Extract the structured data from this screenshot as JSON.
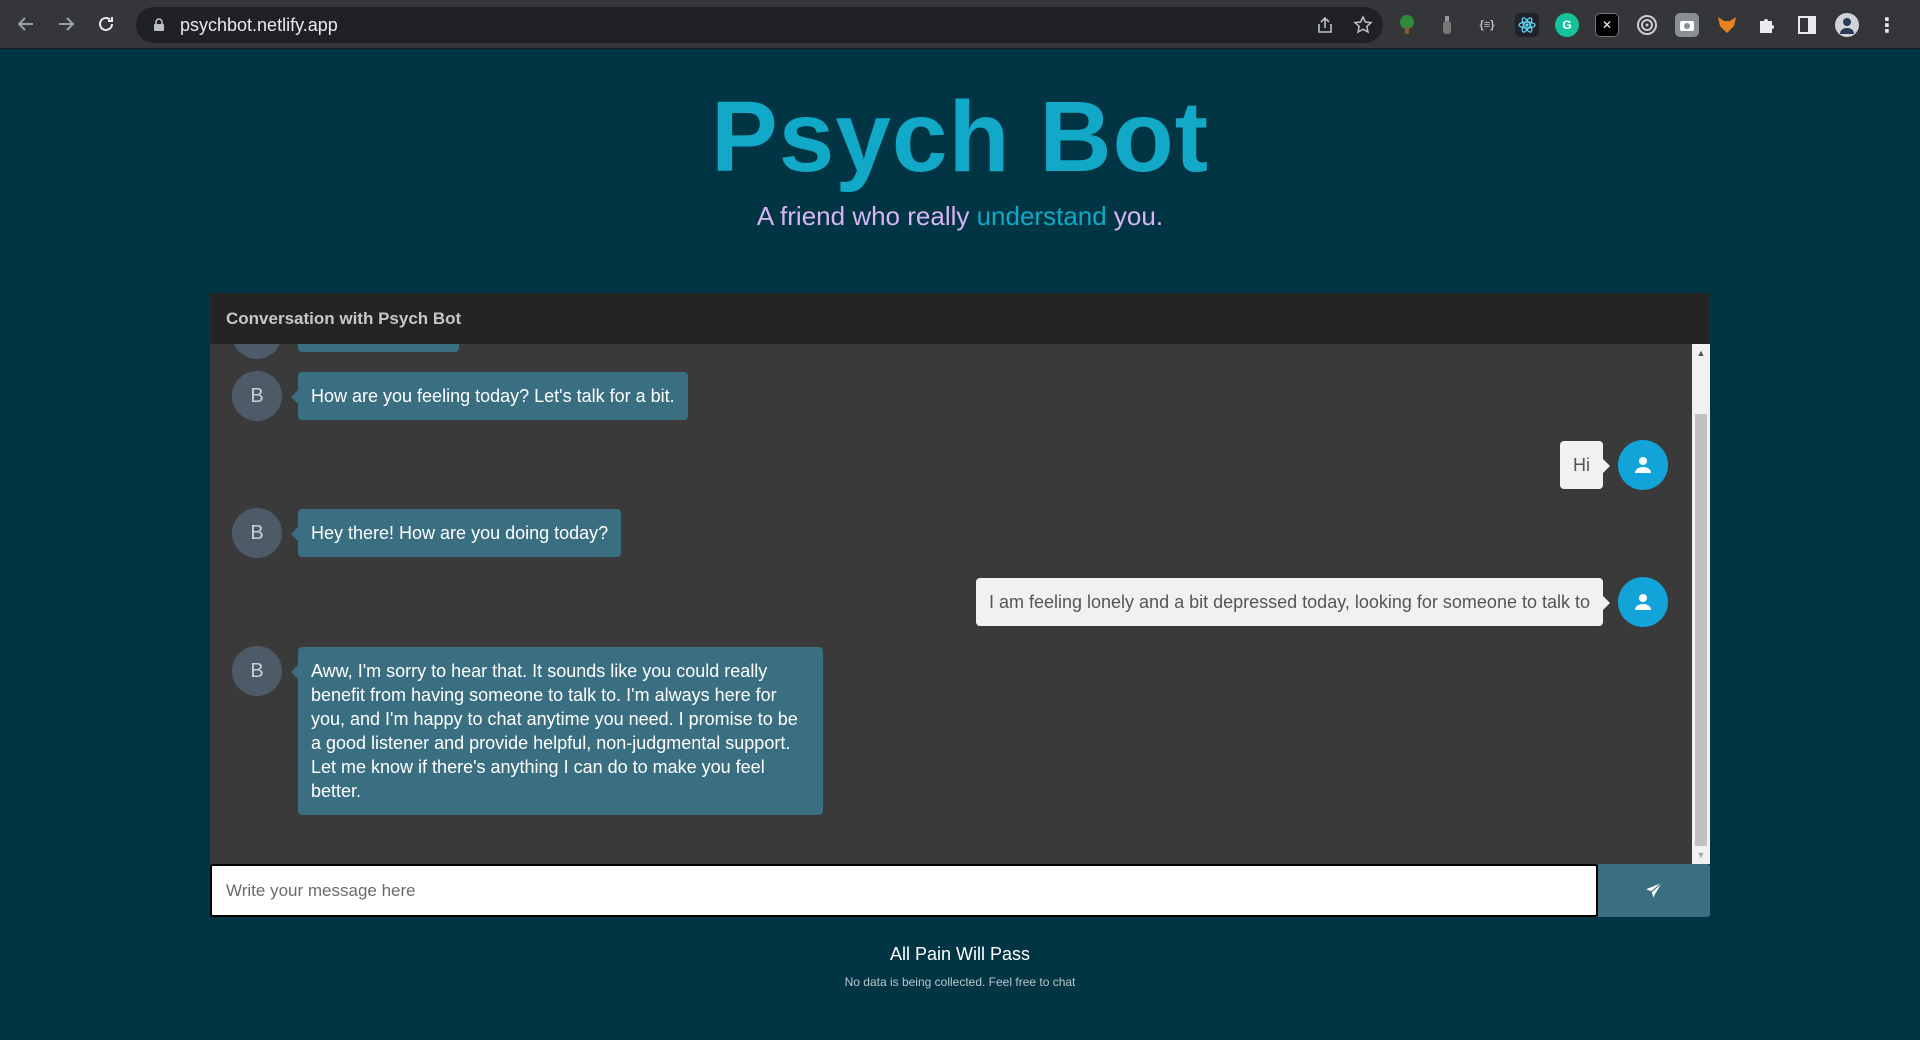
{
  "browser": {
    "url": "psychbot.netlify.app",
    "extensions": [
      "tree-icon",
      "bottle-icon",
      "json-icon",
      "react-icon",
      "grammarly-icon",
      "x-icon",
      "target-icon",
      "camera-icon",
      "fox-icon",
      "puzzle-icon",
      "sidebar-icon",
      "profile-avatar"
    ]
  },
  "header": {
    "title": "Psych Bot",
    "tagline_part1": "A friend who really ",
    "tagline_highlight": "understand",
    "tagline_part2": " you."
  },
  "chat": {
    "header": "Conversation with Psych Bot",
    "bot_initial": "B",
    "messages": [
      {
        "from": "bot",
        "text": "How are you feeling today? Let's talk for a bit."
      },
      {
        "from": "user",
        "text": "Hi"
      },
      {
        "from": "bot",
        "text": "Hey there! How are you doing today?"
      },
      {
        "from": "user",
        "text": "I am feeling lonely and a bit depressed today, looking for someone to talk to"
      },
      {
        "from": "bot",
        "text": "Aww, I'm sorry to hear that. It sounds like you could really benefit from having someone to talk to. I'm always here for you, and I'm happy to chat anytime you need. I promise to be a good listener and provide helpful, non-judgmental support. Let me know if there's anything I can do to make you feel better."
      }
    ],
    "input_placeholder": "Write your message here"
  },
  "footer": {
    "title": "All Pain Will Pass",
    "note": "No data is being collected. Feel free to chat"
  },
  "colors": {
    "page_bg": "#023544",
    "accent": "#11a9c7",
    "tagline": "#d7b4f3",
    "bot_bubble": "#3a6e81",
    "user_avatar": "#12a4d8",
    "chat_bg": "#3a3a3a"
  }
}
